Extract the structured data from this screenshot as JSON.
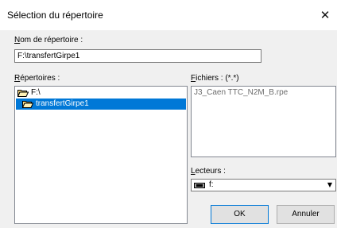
{
  "window": {
    "title": "Sélection du répertoire",
    "close_glyph": "✕"
  },
  "directory_name": {
    "label_accel": "N",
    "label_rest": "om de répertoire :",
    "value": "F:\\transfertGirpe1"
  },
  "directories": {
    "label_accel": "R",
    "label_rest": "épertoires :",
    "items": [
      {
        "label": "F:\\",
        "icon": "open-folder-icon",
        "selected": false
      },
      {
        "label": "transfertGirpe1",
        "icon": "open-folder-icon",
        "selected": true
      }
    ]
  },
  "files": {
    "label_accel": "F",
    "label_rest": "ichiers : (*.*)",
    "items": [
      "J3_Caen TTC_N2M_B.rpe"
    ]
  },
  "drives": {
    "label_accel": "L",
    "label_rest": "ecteurs :",
    "value": "f:",
    "icon": "drive-icon"
  },
  "buttons": {
    "ok": "OK",
    "cancel": "Annuler"
  },
  "colors": {
    "selection": "#0078d7",
    "face": "#f0f0f0"
  }
}
